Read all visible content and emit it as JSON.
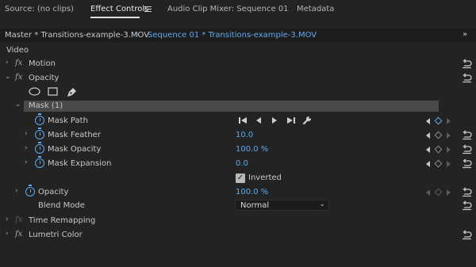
{
  "tabs": [
    {
      "label": "Source: (no clips)",
      "active": false
    },
    {
      "label": "Effect Controls",
      "active": true
    },
    {
      "label": "Audio Clip Mixer: Sequence 01",
      "active": false
    },
    {
      "label": "Metadata",
      "active": false
    }
  ],
  "source_bar": {
    "master_label": "Master * Transitions-example-3.MOV",
    "sequence_label": "Sequence 01 * Transitions-example-3.MOV",
    "chevron": "›",
    "collapse": "»"
  },
  "section": {
    "video_label": "Video"
  },
  "effects": {
    "motion": {
      "fx": "fx",
      "label": "Motion"
    },
    "opacity": {
      "fx": "fx",
      "label": "Opacity"
    },
    "mask": {
      "label": "Mask (1)"
    },
    "mask_path": {
      "label": "Mask Path"
    },
    "mask_feather": {
      "label": "Mask Feather",
      "value": "10.0"
    },
    "mask_opacity": {
      "label": "Mask Opacity",
      "value": "100.0 %"
    },
    "mask_expansion": {
      "label": "Mask Expansion",
      "value": "0.0"
    },
    "inverted": {
      "label": "Inverted",
      "checked": true,
      "check": "✓"
    },
    "opacity_param": {
      "label": "Opacity",
      "value": "100.0 %"
    },
    "blend_mode": {
      "label": "Blend Mode",
      "value": "Normal",
      "caret": "⌄"
    },
    "time_remapping": {
      "fx": "fx",
      "label": "Time Remapping"
    },
    "lumetri_color": {
      "fx": "fx",
      "label": "Lumetri Color"
    }
  },
  "twirls": {
    "closed": "›",
    "open": "⌄"
  },
  "icons": {
    "ellipse_mask": "ellipse-mask-icon",
    "rect_mask": "rectangle-mask-icon",
    "pen_mask": "pen-mask-icon",
    "track_back_one": "track-backward-one-frame-icon",
    "track_back": "track-backward-icon",
    "track_forward": "track-forward-icon",
    "track_forward_one": "track-forward-one-frame-icon",
    "wrench": "wrench-icon",
    "reset": "reset-icon",
    "stopwatch": "stopwatch-icon"
  },
  "colors": {
    "accent_blue": "#5ea9ee",
    "panel_bg": "#232323",
    "mask_bar": "#4a4a4a"
  }
}
